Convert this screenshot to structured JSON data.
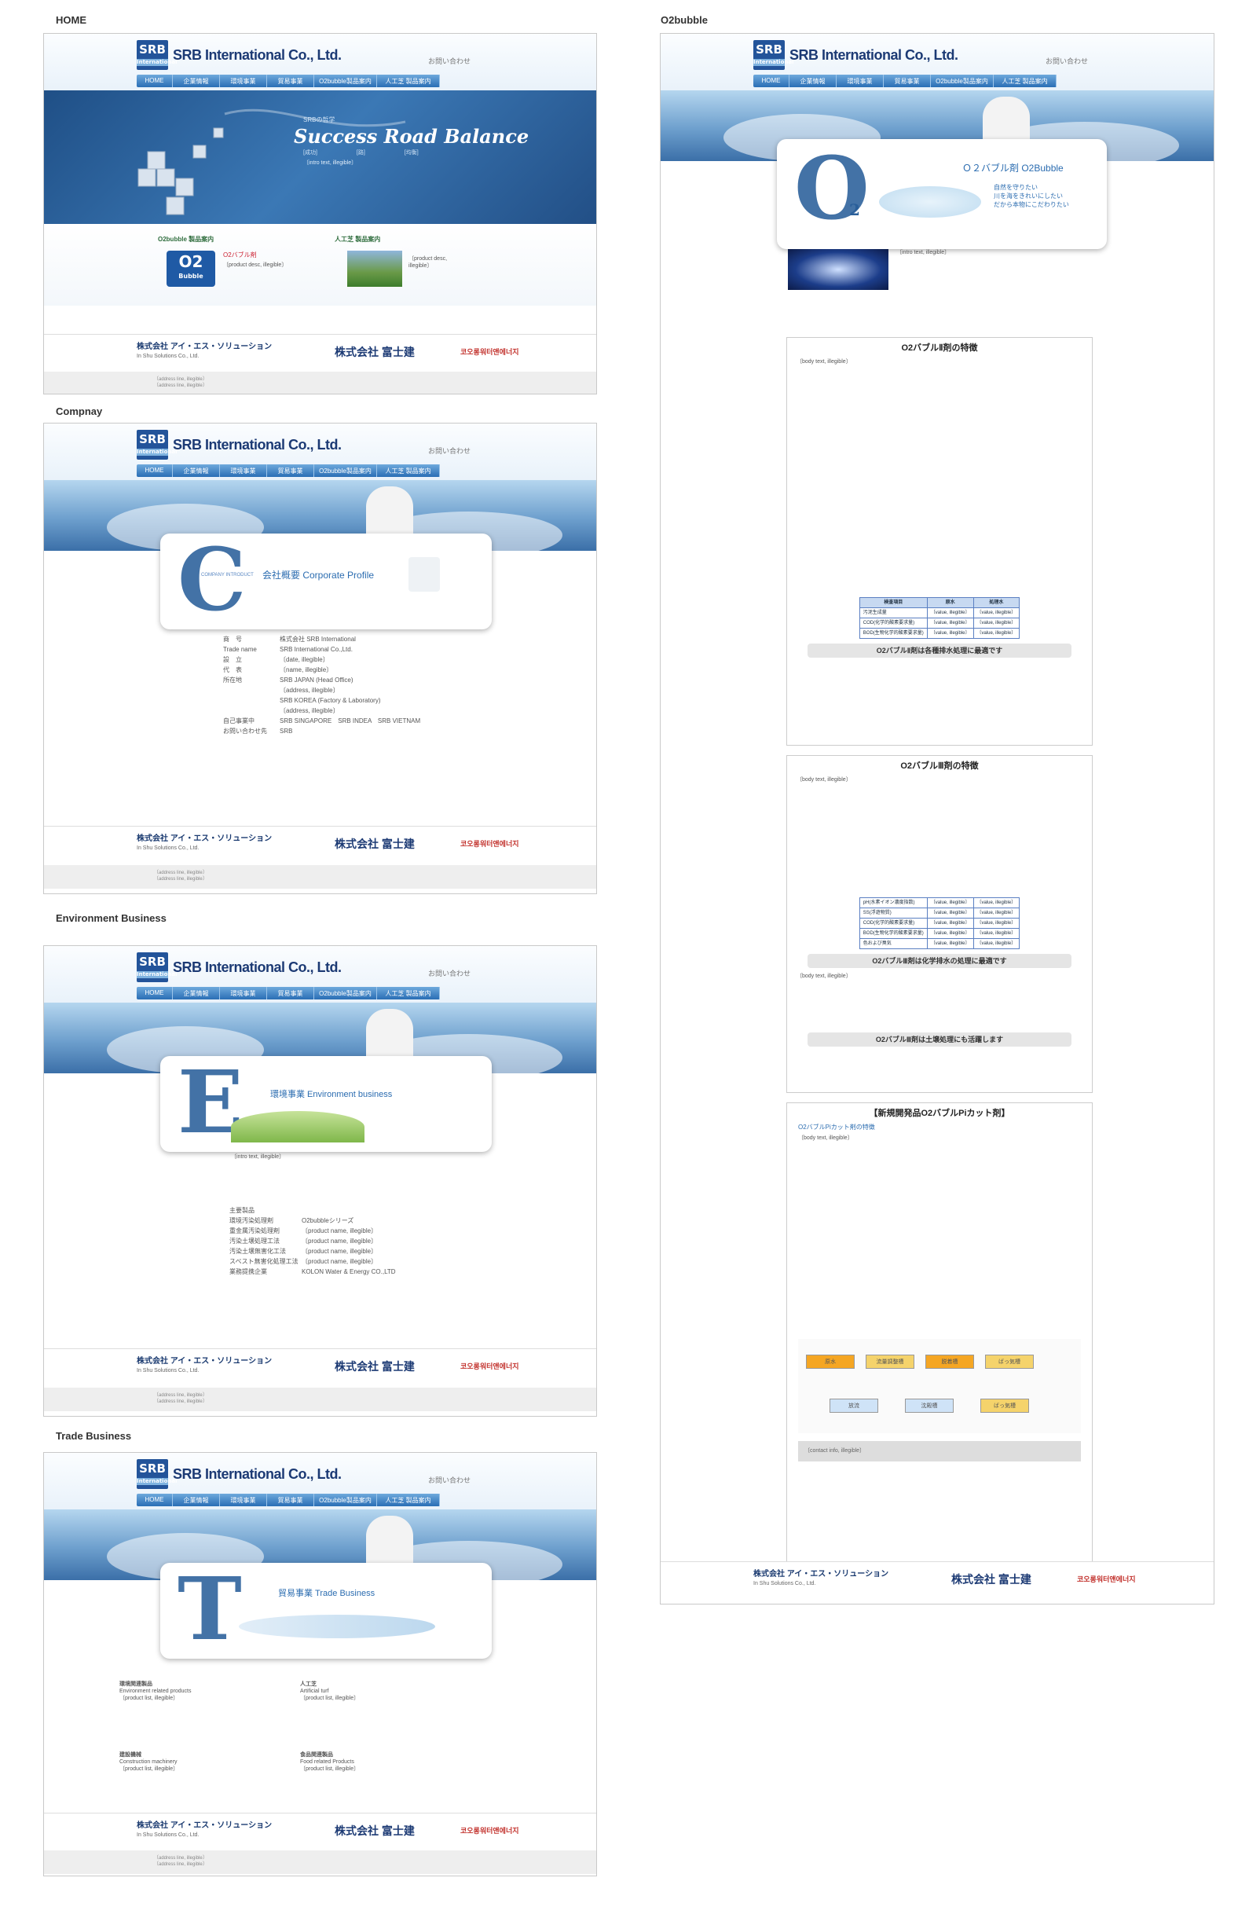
{
  "sections": {
    "home": "HOME",
    "company": "Compnay",
    "env": "Environment Business",
    "trade": "Trade Business",
    "o2": "O2bubble"
  },
  "header": {
    "logo_mark": "SRB",
    "logo_sub": "International",
    "logo_text": "SRB International Co., Ltd.",
    "contact": "お問い合わせ"
  },
  "nav": [
    "HOME",
    "企業情報",
    "環境事業",
    "貿易事業",
    "O2bubble製品案内",
    "人工芝 製品案内"
  ],
  "home": {
    "kicker": "SRBの哲学",
    "headline": "Success Road Balance",
    "tags": [
      "[成功]",
      "[路]",
      "[均衡]"
    ],
    "intro": "〔intro text, illegible〕",
    "o2_title": "O2bubble 製品案内",
    "o2_name": "O2バブル剤",
    "o2_badge_main": "O2",
    "o2_badge_sub": "Bubble",
    "o2_desc": "〔product desc, illegible〕",
    "turf_title": "人工芝 製品案内",
    "turf_desc": "〔product desc, illegible〕"
  },
  "footer": {
    "notice": "〔notice, illegible〕",
    "brand1": "株式会社 アイ・エス・ソリューション",
    "brand1_sub": "In Shu Solutions Co., Ltd.",
    "brand2": "株式会社 富士建",
    "brand3": "코오롱워터앤에너지",
    "address": "〔address line, illegible〕",
    "address2": "〔address line, illegible〕"
  },
  "company": {
    "letter": "C",
    "small": "COMPANY INTRODUCT",
    "title": "会社概要 Corporate Profile",
    "rows": [
      [
        "商　号",
        "株式会社 SRB International"
      ],
      [
        "Trade name",
        "SRB International Co.,Ltd."
      ],
      [
        "設　立",
        "〔date, illegible〕"
      ],
      [
        "代　表",
        "〔name, illegible〕"
      ],
      [
        "所在地",
        "SRB JAPAN (Head Office)"
      ],
      [
        "",
        "〔address, illegible〕"
      ],
      [
        "",
        "SRB KOREA (Factory & Laboratory)"
      ],
      [
        "",
        "〔address, illegible〕"
      ],
      [
        "自己事業中",
        "SRB SINGAPORE　SRB INDEA　SRB VIETNAM"
      ],
      [
        "お問い合わせ先",
        "SRB"
      ]
    ]
  },
  "env": {
    "letter": "E",
    "title": "環境事業 Environment business",
    "intro": "〔intro text, illegible〕",
    "rows": [
      [
        "主要製品",
        ""
      ],
      [
        "環境汚染処理剤",
        "O2bubbleシリーズ"
      ],
      [
        "重金属汚染処理剤",
        "〔product name, illegible〕"
      ],
      [
        "汚染土壌処理工法",
        "〔product name, illegible〕"
      ],
      [
        "汚染土壌無害化工法",
        "〔product name, illegible〕"
      ],
      [
        "スベスト無害化処理工法",
        "〔product name, illegible〕"
      ],
      [
        "業務提携企業",
        "KOLON Water & Energy CO.,LTD"
      ]
    ]
  },
  "trade": {
    "letter": "T",
    "title": "貿易事業 Trade Business",
    "items": [
      [
        "環境関連製品",
        "Environment related products",
        "〔product list, illegible〕"
      ],
      [
        "人工芝",
        "Artificial turf",
        "〔product list, illegible〕"
      ],
      [
        "建設機械",
        "Construction machinery",
        "〔product list, illegible〕"
      ],
      [
        "食品関連製品",
        "Food related Products",
        "〔product list, illegible〕"
      ]
    ]
  },
  "o2": {
    "letter": "O",
    "sub": "2",
    "title": "Ｏ２バブル剤 O2Bubble",
    "slogan": [
      "自然を守りたい",
      "川を海をきれいにしたい",
      "だから本物にこだわりたい"
    ],
    "intro": "〔intro text, illegible〕",
    "s1": "O2バブルⅡ剤の特徴",
    "s1_table_head": [
      "検査項目",
      "原水",
      "処理水"
    ],
    "s1_rows": [
      [
        "汚泥生成量",
        "〔value, illegible〕",
        "〔value, illegible〕"
      ],
      [
        "COD(化学的酸素要求量)",
        "〔value, illegible〕",
        "〔value, illegible〕"
      ],
      [
        "BOD(生物化学的酸素要求量)",
        "〔value, illegible〕",
        "〔value, illegible〕"
      ]
    ],
    "s1_banner": "O2バブルⅡ剤は各種排水処理に最適です",
    "s2": "O2バブルⅢ剤の特徴",
    "s2_rows": [
      [
        "pH(水素イオン濃度指数)",
        "〔value, illegible〕",
        "〔value, illegible〕"
      ],
      [
        "SS(浮遊物質)",
        "〔value, illegible〕",
        "〔value, illegible〕"
      ],
      [
        "COD(化学的酸素要求量)",
        "〔value, illegible〕",
        "〔value, illegible〕"
      ],
      [
        "BOD(生物化学的酸素要求量)",
        "〔value, illegible〕",
        "〔value, illegible〕"
      ],
      [
        "色および臭気",
        "〔value, illegible〕",
        "〔value, illegible〕"
      ]
    ],
    "s2_banner": "O2バブルⅢ剤は化学排水の処理に最適です",
    "s2_banner2": "O2バブルⅢ剤は土壌処理にも活躍します",
    "s3": "【新規開発品O2バブルPiカット剤】",
    "s3_sub": "O2バブルPiカット剤の特徴",
    "flow": [
      "原水",
      "流量調整槽",
      "脱着槽",
      "ばっ気槽",
      "放流",
      "沈殿槽",
      "ばっ気槽"
    ],
    "contact": "〔contact info, illegible〕",
    "body": "〔body text, illegible〕"
  }
}
